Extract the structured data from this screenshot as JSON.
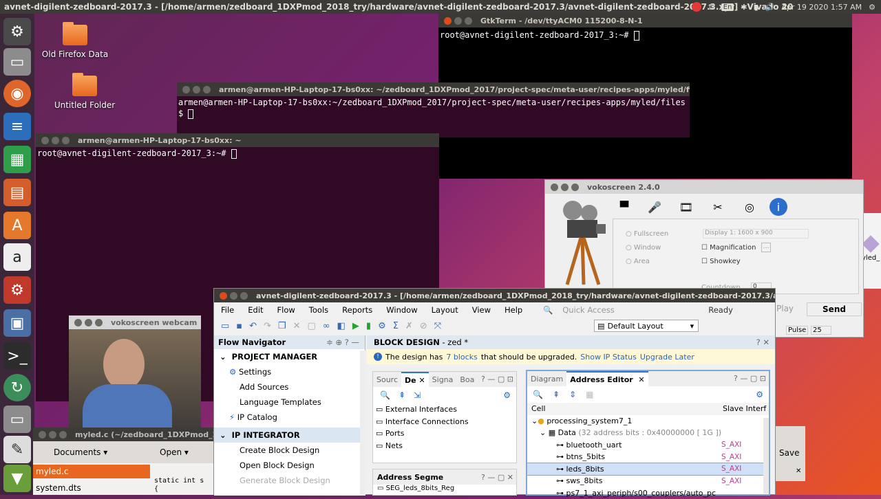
{
  "topbar": {
    "title": "avnet-digilent-zedboard-2017.3 - [/home/armen/zedboard_1DXPmod_2018_try/hardware/avnet-digilent-zedboard-2017.3/avnet-digilent-zedboard-2017.3.xpr] - Vivado 20",
    "lang": "En",
    "clock": "Apr 19 2020  1:57 AM"
  },
  "desktop": {
    "icons": [
      {
        "label": "Old Firefox Data"
      },
      {
        "label": "Untitled Folder"
      }
    ]
  },
  "launcher": {
    "items": [
      "settings-icon",
      "files-icon",
      "firefox-icon",
      "writer-icon",
      "calc-icon",
      "impress-icon",
      "software-icon",
      "amazon-icon",
      "system-settings-icon",
      "screenshot-icon",
      "terminal-icon",
      "updater-icon",
      "files2-icon",
      "text-editor-icon",
      "trash-icon"
    ]
  },
  "gtkterm": {
    "title": "GtkTerm - /dev/ttyACM0  115200-8-N-1",
    "line": "root@avnet-digilent-zedboard-2017_3:~# "
  },
  "term1": {
    "title": "armen@armen-HP-Laptop-17-bs0xx: ~/zedboard_1DXPmod_2017/project-spec/meta-user/recipes-apps/myled/files",
    "line1": "armen@armen-HP-Laptop-17-bs0xx:~/zedboard_1DXPmod_2017/project-spec/meta-user/recipes-apps/myled/files",
    "line2": "$ "
  },
  "term2": {
    "title": "armen@armen-HP-Laptop-17-bs0xx: ~",
    "line": "root@avnet-digilent-zedboard-2017_3:~# "
  },
  "voko": {
    "title": "vokoscreen 2.4.0",
    "fullscreen": "Fullscreen",
    "window": "Window",
    "area": "Area",
    "display": "Display 1:  1600 x 900",
    "magnification": "Magnification",
    "showkey": "Showkey",
    "countdown": "Countdown",
    "countdown_val": "0",
    "play": "Play",
    "send": "Send",
    "pulse": "Pulse",
    "pulse_val": "25"
  },
  "webcam": {
    "title": "vokoscreen webcam"
  },
  "gedit": {
    "title": "myled.c (~/zedboard_1DXPmod_2017/",
    "documents": "Documents",
    "open": "Open",
    "save": "Save",
    "files": [
      "myled.c",
      "system.dts"
    ],
    "code1": "static int s",
    "code2": "{"
  },
  "vivado": {
    "title": "avnet-digilent-zedboard-2017.3 - [/home/armen/zedboard_1DXPmod_2018_try/hardware/avnet-digilent-zedboard-2017.3/avnet-c",
    "menu": [
      "File",
      "Edit",
      "Flow",
      "Tools",
      "Reports",
      "Window",
      "Layout",
      "View",
      "Help"
    ],
    "quick_access": "Quick Access",
    "status": "Ready",
    "layout": "Default Layout",
    "flow_nav": {
      "title": "Flow Navigator",
      "project_manager": "PROJECT MANAGER",
      "pm_items": [
        "Settings",
        "Add Sources",
        "Language Templates",
        "IP Catalog"
      ],
      "ip_integrator": "IP INTEGRATOR",
      "ii_items": [
        "Create Block Design",
        "Open Block Design",
        "Generate Block Design"
      ]
    },
    "block_design": {
      "title": "BLOCK DESIGN",
      "name": "- zed *",
      "banner_a": "The design has",
      "banner_blocks": "7 blocks",
      "banner_b": "that should be upgraded.",
      "show_ip": "Show IP Status",
      "upgrade_later": "Upgrade Later",
      "left_tabs": [
        "Sourc",
        "De",
        "Signa",
        "Boa"
      ],
      "tree": [
        "External Interfaces",
        "Interface Connections",
        "Ports",
        "Nets"
      ],
      "addr_seg_title": "Address Segme",
      "addr_seg_row": "SEG_leds_8bits_Reg",
      "right_tabs": [
        "Diagram",
        "Address Editor"
      ],
      "col_cell": "Cell",
      "col_slave": "Slave Interf",
      "rows": [
        {
          "name": "processing_system7_1",
          "slave": ""
        },
        {
          "name": "Data",
          "note": "(32 address bits : 0x40000000 [ 1G ])",
          "slave": ""
        },
        {
          "name": "bluetooth_uart",
          "slave": "S_AXI"
        },
        {
          "name": "btns_5bits",
          "slave": "S_AXI"
        },
        {
          "name": "leds_8bits",
          "slave": "S_AXI"
        },
        {
          "name": "sws_8bits",
          "slave": "S_AXI"
        },
        {
          "name": "ps7_1_axi_periph/s00_couplers/auto_pc",
          "slave": ""
        }
      ]
    }
  },
  "partial_right": {
    "label": "yled_"
  }
}
